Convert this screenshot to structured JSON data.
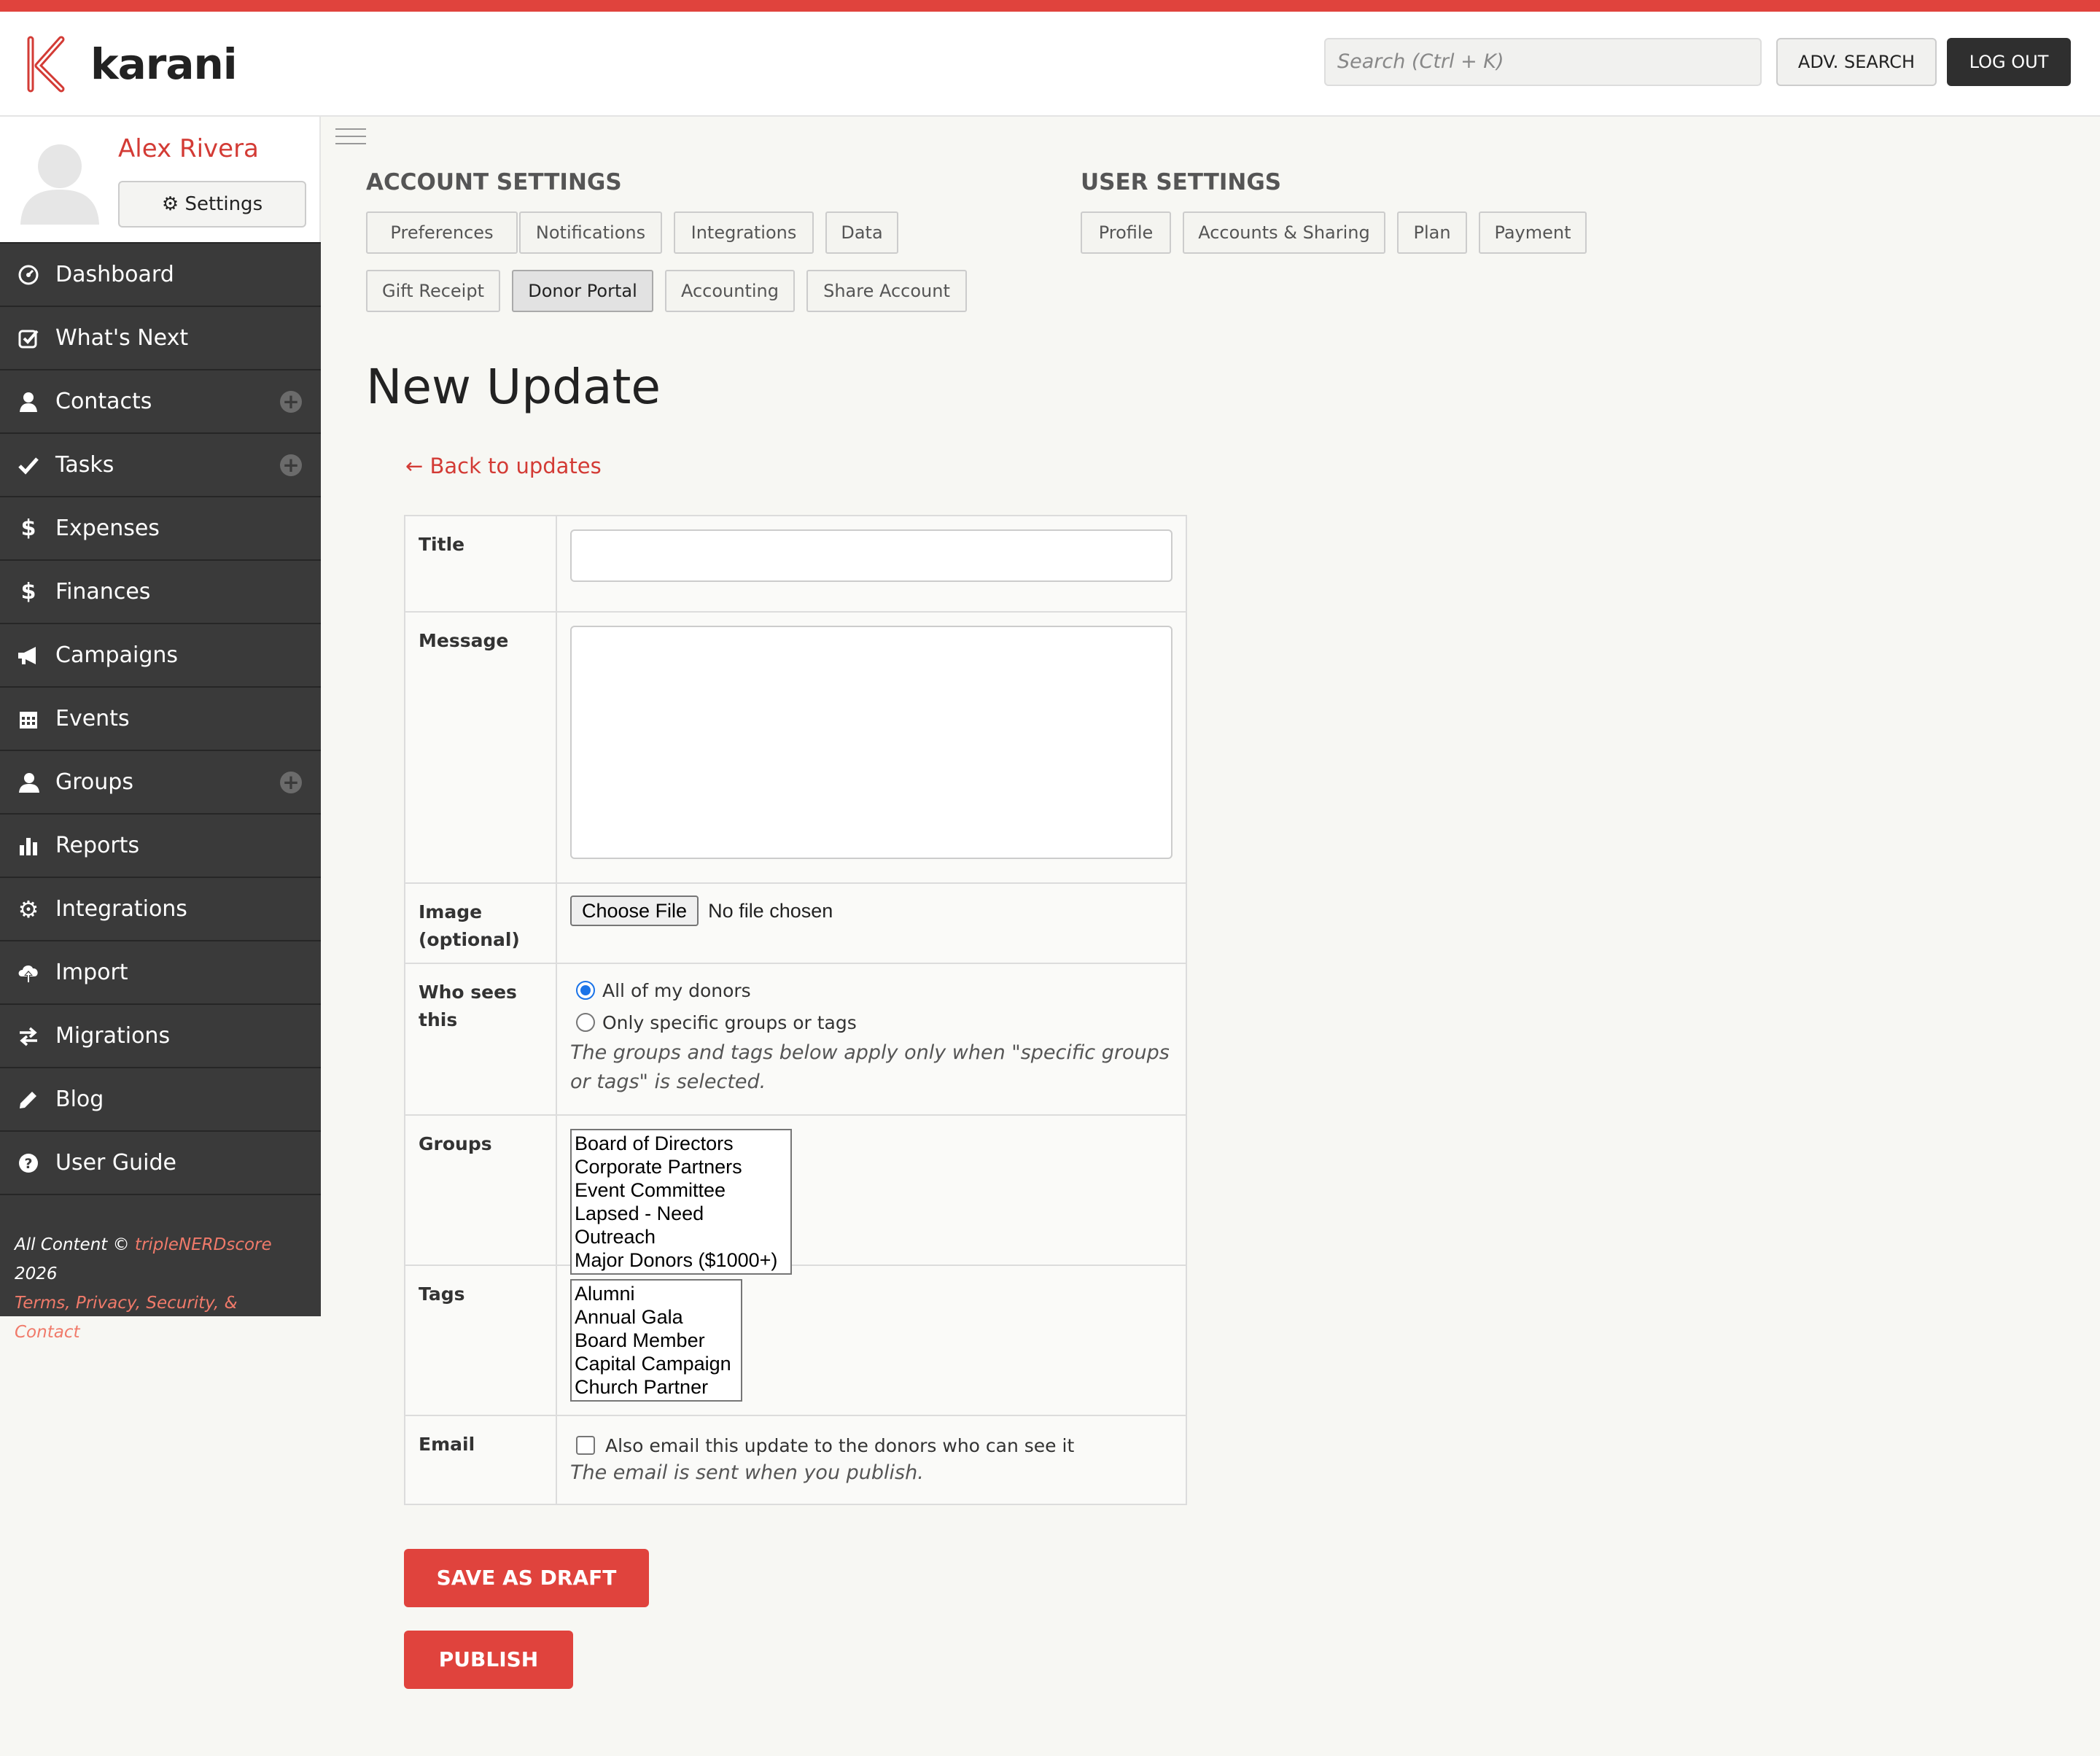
{
  "brand": {
    "name": "karani",
    "accent": "#e0433d"
  },
  "header": {
    "search_placeholder": "Search (Ctrl + K)",
    "adv_search": "ADV. SEARCH",
    "logout": "LOG OUT"
  },
  "profile": {
    "name": "Alex Rivera",
    "settings_label": "Settings"
  },
  "nav": [
    {
      "label": "Dashboard",
      "icon": "dashboard-icon"
    },
    {
      "label": "What's Next",
      "icon": "check-square-icon"
    },
    {
      "label": "Contacts",
      "icon": "person-icon",
      "plus": true
    },
    {
      "label": "Tasks",
      "icon": "check-icon",
      "plus": true
    },
    {
      "label": "Expenses",
      "icon": "dollar-icon"
    },
    {
      "label": "Finances",
      "icon": "dollar-icon"
    },
    {
      "label": "Campaigns",
      "icon": "megaphone-icon"
    },
    {
      "label": "Events",
      "icon": "calendar-icon"
    },
    {
      "label": "Groups",
      "icon": "group-icon",
      "plus": true
    },
    {
      "label": "Reports",
      "icon": "bar-chart-icon"
    },
    {
      "label": "Integrations",
      "icon": "gear-icon"
    },
    {
      "label": "Import",
      "icon": "cloud-upload-icon"
    },
    {
      "label": "Migrations",
      "icon": "swap-icon"
    },
    {
      "label": "Blog",
      "icon": "pencil-icon"
    },
    {
      "label": "User Guide",
      "icon": "question-icon"
    }
  ],
  "footer": {
    "prefix": "All Content ©",
    "company": "tripleNERDscore",
    "year": "2026",
    "links": "Terms, Privacy, Security, & Contact"
  },
  "account_settings": {
    "title": "ACCOUNT SETTINGS",
    "tabs": [
      "Preferences",
      "Notifications",
      "Integrations",
      "Data",
      "Gift Receipt",
      "Donor Portal",
      "Accounting",
      "Share Account"
    ],
    "active": "Donor Portal"
  },
  "user_settings": {
    "title": "USER SETTINGS",
    "tabs": [
      "Profile",
      "Accounts & Sharing",
      "Plan",
      "Payment"
    ]
  },
  "page": {
    "title": "New Update",
    "back_link": "← Back to updates"
  },
  "form": {
    "title_label": "Title",
    "title_value": "",
    "message_label": "Message",
    "message_value": "",
    "image_label": "Image (optional)",
    "file_button": "Choose File",
    "file_status": "No file chosen",
    "audience_label": "Who sees this",
    "audience_options": [
      "All of my donors",
      "Only specific groups or tags"
    ],
    "audience_selected": "All of my donors",
    "audience_help": "The groups and tags below apply only when \"specific groups or tags\" is selected.",
    "groups_label": "Groups",
    "groups": [
      "Board of Directors",
      "Corporate Partners",
      "Event Committee",
      "Lapsed - Need Outreach",
      "Major Donors ($1000+)"
    ],
    "tags_label": "Tags",
    "tags": [
      "Alumni",
      "Annual Gala",
      "Board Member",
      "Capital Campaign",
      "Church Partner"
    ],
    "email_label": "Email",
    "email_checkbox": "Also email this update to the donors who can see it",
    "email_checked": false,
    "email_help": "The email is sent when you publish."
  },
  "actions": {
    "save_draft": "SAVE AS DRAFT",
    "publish": "PUBLISH"
  }
}
